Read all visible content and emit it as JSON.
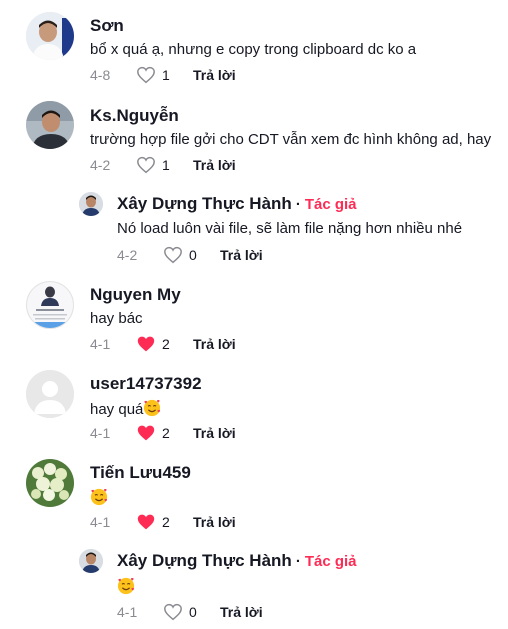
{
  "reply_label": "Trả lời",
  "author_label": "Tác giả",
  "colors": {
    "liked": "#fe2c55",
    "muted": "#8a8b91",
    "text": "#161823"
  },
  "comments": [
    {
      "name": "Sơn",
      "text": "bổ x quá ạ, nhưng e copy trong clipboard dc ko a",
      "date": "4-8",
      "likes": "1",
      "liked": false
    },
    {
      "name": "Ks.Nguyễn",
      "text": "trường hợp file gởi cho CDT vẫn xem đc hình không ad, hay",
      "date": "4-2",
      "likes": "1",
      "liked": false
    },
    {
      "name": "Xây Dựng Thực Hành",
      "text": "Nó load luôn vài file, sẽ làm file nặng hơn nhiều nhé",
      "date": "4-2",
      "likes": "0",
      "liked": false,
      "is_reply": true,
      "is_author": true
    },
    {
      "name": "Nguyen My",
      "text": "hay bác",
      "date": "4-1",
      "likes": "2",
      "liked": true
    },
    {
      "name": "user14737392",
      "text": "hay quá",
      "emoji": "smiling-face-with-hearts",
      "date": "4-1",
      "likes": "2",
      "liked": true
    },
    {
      "name": "Tiến Lưu459",
      "text": "",
      "emoji": "smiling-face-with-hearts",
      "date": "4-1",
      "likes": "2",
      "liked": true
    },
    {
      "name": "Xây Dựng Thực Hành",
      "text": "",
      "emoji": "smiling-face-with-hearts",
      "date": "4-1",
      "likes": "0",
      "liked": false,
      "is_reply": true,
      "is_author": true
    }
  ]
}
